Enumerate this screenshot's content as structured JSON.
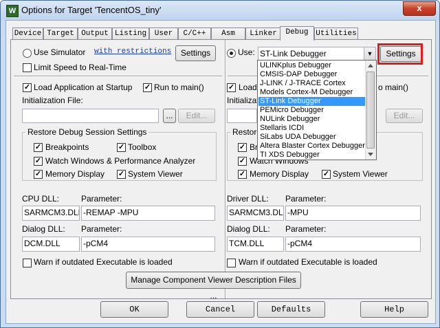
{
  "window": {
    "title": "Options for Target 'TencentOS_tiny'",
    "close_glyph": "x",
    "app_icon_glyph": "W"
  },
  "tabs": [
    "Device",
    "Target",
    "Output",
    "Listing",
    "User",
    "C/C++",
    "Asm",
    "Linker",
    "Debug",
    "Utilities"
  ],
  "active_tab": "Debug",
  "left": {
    "use_simulator": "Use Simulator",
    "with_restrictions": "with restrictions",
    "settings": "Settings",
    "limit_speed": "Limit Speed to Real-Time",
    "load_app": "Load Application at Startup",
    "run_to_main": "Run to main()",
    "init_file_label": "Initialization File:",
    "browse": "...",
    "edit": "Edit...",
    "restore_group": "Restore Debug Session Settings",
    "breakpoints": "Breakpoints",
    "toolbox": "Toolbox",
    "watch_windows": "Watch Windows & Performance Analyzer",
    "memory_display": "Memory Display",
    "system_viewer": "System Viewer",
    "cpu_dll_label": "CPU DLL:",
    "cpu_dll_value": "SARMCM3.DLL",
    "param_label": "Parameter:",
    "cpu_param_value": "-REMAP -MPU",
    "dialog_dll_label": "Dialog DLL:",
    "dialog_dll_value": "DCM.DLL",
    "dialog_param_label": "Parameter:",
    "dialog_param_value": "-pCM4",
    "warn": "Warn if outdated Executable is loaded"
  },
  "right": {
    "use_label": "Use:",
    "debugger_value": "ST-Link Debugger",
    "settings": "Settings",
    "load_partial": "Load",
    "run_to_main_partial": "o main()",
    "init_file_partial": "Initialization",
    "edit": "Edit...",
    "restore_partial": "Restore",
    "breakpoints_partial": "Bre",
    "watch_windows": "Watch Windows",
    "memory_display": "Memory Display",
    "system_viewer": "System Viewer",
    "driver_dll_label": "Driver DLL:",
    "driver_dll_value": "SARMCM3.DLL",
    "param_label": "Parameter:",
    "driver_param_value": "-MPU",
    "dialog_dll_label": "Dialog DLL:",
    "dialog_dll_value": "TCM.DLL",
    "dialog_param_label": "Parameter:",
    "dialog_param_value": "-pCM4",
    "warn": "Warn if outdated Executable is loaded"
  },
  "dropdown": {
    "items": [
      "ULINKplus Debugger",
      "CMSIS-DAP Debugger",
      "J-LINK / J-TRACE Cortex",
      "Models Cortex-M Debugger",
      "ST-Link Debugger",
      "PEMicro Debugger",
      "NULink Debugger",
      "Stellaris ICDI",
      "SiLabs UDA Debugger",
      "Altera Blaster Cortex Debugger",
      "TI XDS Debugger"
    ],
    "selected": "ST-Link Debugger"
  },
  "manage_button": "Manage Component Viewer Description Files ...",
  "footer": {
    "ok": "OK",
    "cancel": "Cancel",
    "defaults": "Defaults",
    "help": "Help"
  },
  "highlight_color": "#e31b1b"
}
